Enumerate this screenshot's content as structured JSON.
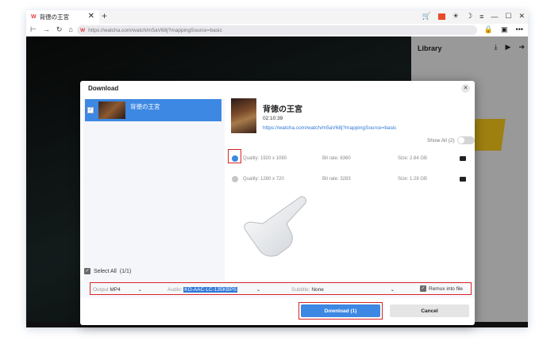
{
  "tab": {
    "logo": "W",
    "title": "背徳の王宮",
    "close": "✕",
    "new": "+"
  },
  "address": {
    "logo": "W",
    "url": "https://watcha.com/watch/m5aV68j?mappingSource=basic"
  },
  "library": {
    "title": "Library"
  },
  "dialog": {
    "title": "Download",
    "close": "✕",
    "list": [
      {
        "title": "背徳の王宮"
      }
    ],
    "select_all": "Select All",
    "select_count": "(1/1)",
    "video": {
      "title": "背徳の王宮",
      "duration": "02:10:39",
      "url": "https://watcha.com/watch/m5aV68j?mappingSource=basic"
    },
    "show_all": "Show All (2)",
    "qualities": [
      {
        "quality": "Quality: 1920 x 1080",
        "bitrate": "Bit rate: 6360",
        "size": "Size: 2.84 GB",
        "selected": true
      },
      {
        "quality": "Quality: 1280 x 720",
        "bitrate": "Bit rate: 3283",
        "size": "Size: 1.28 GB",
        "selected": false
      }
    ],
    "options": {
      "output_label": "Output",
      "output_value": "MP4",
      "audio_label": "Audio:",
      "audio_value": "KO-AAC-LC-135KBPS",
      "subtitle_label": "Subtitle:",
      "subtitle_value": "None",
      "remux_label": "Remux into file"
    },
    "download_button": "Download (1)",
    "cancel_button": "Cancel"
  },
  "colors": {
    "accent": "#3d88e3",
    "highlight_border": "#d9232a",
    "logo": "#e23d3d"
  }
}
